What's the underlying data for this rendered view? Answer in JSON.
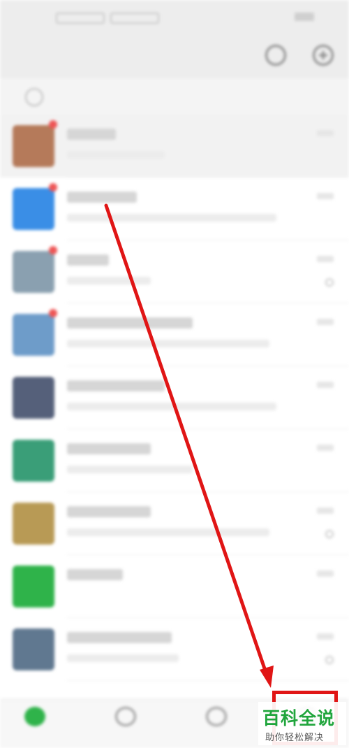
{
  "status_bar": {
    "icons": [
      "signal-icon",
      "wifi-icon",
      "battery-icon"
    ]
  },
  "header": {
    "title": "",
    "icons": [
      "search-icon",
      "add-circle-icon"
    ]
  },
  "banner": {
    "text": ""
  },
  "chats": [
    {
      "avatar_color": "#b57a5a",
      "badge": true,
      "pinned": true
    },
    {
      "avatar_color": "#3a8ee6",
      "badge": true,
      "pinned": false
    },
    {
      "avatar_color": "#8aa0b0",
      "badge": true,
      "pinned": false
    },
    {
      "avatar_color": "#6e9cc9",
      "badge": true,
      "pinned": false
    },
    {
      "avatar_color": "#55607a",
      "badge": false,
      "pinned": false
    },
    {
      "avatar_color": "#3a9e78",
      "badge": false,
      "pinned": false
    },
    {
      "avatar_color": "#b89a55",
      "badge": false,
      "pinned": false
    },
    {
      "avatar_color": "#2fb34a",
      "badge": false,
      "pinned": false
    },
    {
      "avatar_color": "#607890",
      "badge": false,
      "pinned": false
    }
  ],
  "tab_bar": {
    "active_color": "#2fb34a",
    "tabs": [
      {
        "icon": "chat-bubble-icon",
        "active": true
      },
      {
        "icon": "contacts-icon",
        "active": false
      },
      {
        "icon": "discover-icon",
        "active": false
      },
      {
        "icon": "me-icon",
        "active": false
      }
    ]
  },
  "annotation": {
    "color": "#e01515"
  },
  "watermark": {
    "title": "百科全说",
    "subtitle": "助你轻松解决",
    "color": "#20a53c"
  }
}
